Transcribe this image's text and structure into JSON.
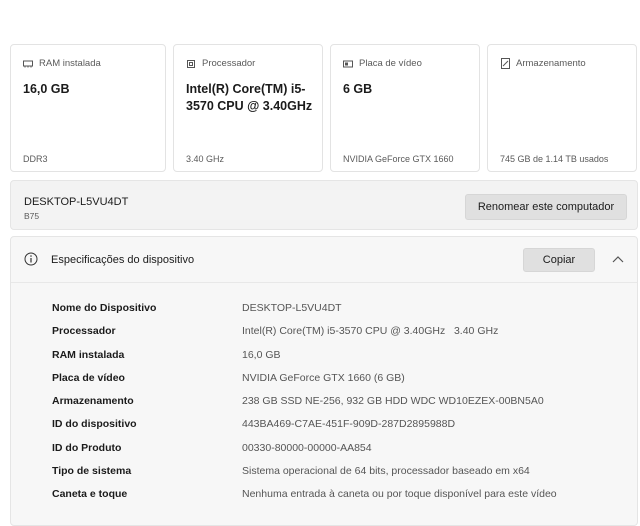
{
  "cards": [
    {
      "icon": "ram-icon",
      "label": "RAM instalada",
      "value": "16,0 GB",
      "sub": "DDR3"
    },
    {
      "icon": "processor-icon",
      "label": "Processador",
      "value": "Intel(R) Core(TM) i5-3570 CPU @ 3.40GHz",
      "sub": "3.40 GHz"
    },
    {
      "icon": "video-card-icon",
      "label": "Placa de vídeo",
      "value": "6 GB",
      "sub": "NVIDIA GeForce GTX 1660"
    },
    {
      "icon": "storage-icon",
      "label": "Armazenamento",
      "value": "",
      "sub": "745 GB de 1.14 TB usados"
    }
  ],
  "computer": {
    "name": "DESKTOP-L5VU4DT",
    "model": "B75",
    "rename_label": "Renomear este computador"
  },
  "specs": {
    "title": "Especificações do dispositivo",
    "copy_label": "Copiar",
    "rows": [
      {
        "key": "Nome do Dispositivo",
        "value": "DESKTOP-L5VU4DT"
      },
      {
        "key": "Processador",
        "value": "Intel(R) Core(TM) i5-3570 CPU @ 3.40GHz   3.40 GHz"
      },
      {
        "key": "RAM instalada",
        "value": "16,0 GB"
      },
      {
        "key": "Placa de vídeo",
        "value": "NVIDIA GeForce GTX 1660 (6 GB)"
      },
      {
        "key": "Armazenamento",
        "value": "238 GB SSD NE-256, 932 GB HDD WDC WD10EZEX-00BN5A0"
      },
      {
        "key": "ID do dispositivo",
        "value": "443BA469-C7AE-451F-909D-287D2895988D"
      },
      {
        "key": "ID do Produto",
        "value": "00330-80000-00000-AA854"
      },
      {
        "key": "Tipo de sistema",
        "value": "Sistema operacional de 64 bits, processador baseado em x64"
      },
      {
        "key": "Caneta e toque",
        "value": "Nenhuma entrada à caneta ou por toque disponível para este vídeo"
      }
    ]
  }
}
